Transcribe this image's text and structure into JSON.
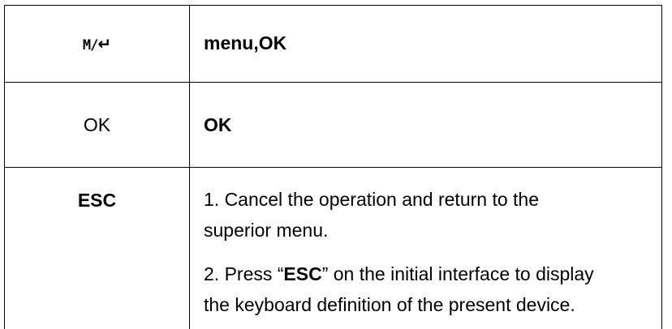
{
  "rows": [
    {
      "key_text": "",
      "key_icons": [
        "M",
        "/"
      ],
      "key_icon_names": [
        "menu-key-icon",
        "enter-key-icon"
      ],
      "description": "menu,OK"
    },
    {
      "key_text": "OK",
      "description": "OK"
    },
    {
      "key_text": "ESC",
      "description_items": [
        {
          "lines": [
            "1. Cancel the operation and return to the",
            "superior menu."
          ]
        },
        {
          "prefix": "2. Press “",
          "bold": "ESC",
          "suffix": "” on the initial interface to display",
          "line2": "the keyboard definition of the present device."
        }
      ]
    }
  ]
}
